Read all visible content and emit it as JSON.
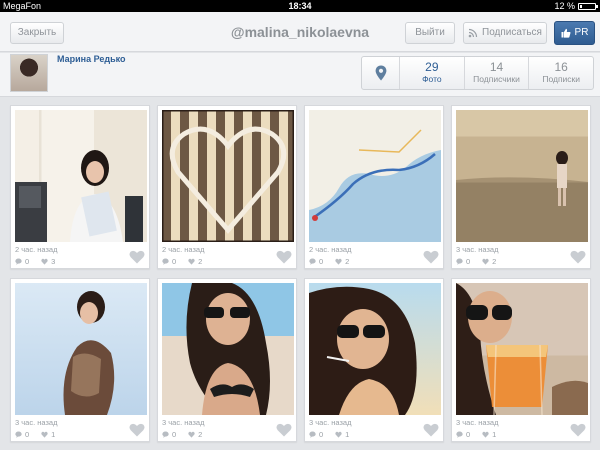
{
  "status_bar": {
    "carrier": "MegaFon",
    "time": "18:34",
    "battery": "12 %"
  },
  "topbar": {
    "close_label": "Закрыть",
    "username": "@malina_nikolaevna",
    "logout_label": "Выйти",
    "subscribe_label": "Подписаться",
    "pr_label": "PR"
  },
  "profile": {
    "name": "Марина Редько",
    "stats": [
      {
        "value": "29",
        "label": "Фото"
      },
      {
        "value": "14",
        "label": "Подписчики"
      },
      {
        "value": "16",
        "label": "Подписки"
      }
    ]
  },
  "photos": [
    {
      "time": "2 час. назад",
      "comments": "0",
      "likes": "3"
    },
    {
      "time": "2 час. назад",
      "comments": "0",
      "likes": "2"
    },
    {
      "time": "2 час. назад",
      "comments": "0",
      "likes": "2"
    },
    {
      "time": "3 час. назад",
      "comments": "0",
      "likes": "2"
    },
    {
      "time": "3 час. назад",
      "comments": "0",
      "likes": "1"
    },
    {
      "time": "3 час. назад",
      "comments": "0",
      "likes": "2"
    },
    {
      "time": "3 час. назад",
      "comments": "0",
      "likes": "1"
    },
    {
      "time": "3 час. назад",
      "comments": "0",
      "likes": "1"
    }
  ],
  "colors": {
    "accent": "#2e5e95",
    "pr_button": "#3a6aa2",
    "background": "#e3e5e8"
  },
  "icons": {
    "location": "map-pin-icon",
    "subscribe": "rss-icon",
    "pr": "thumbs-up-icon",
    "comment": "comment-icon",
    "like": "heart-icon"
  }
}
